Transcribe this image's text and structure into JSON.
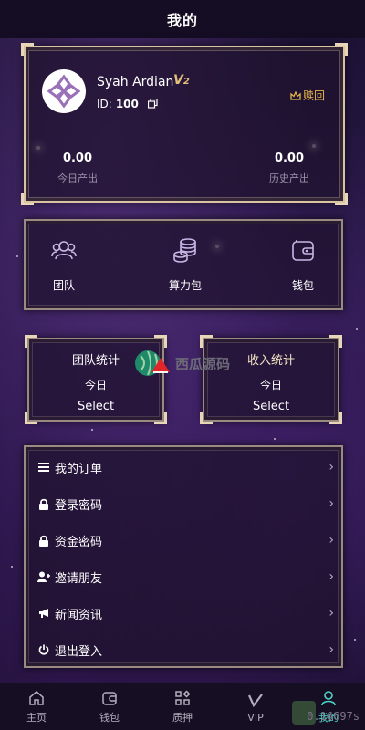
{
  "header": {
    "title": "我的"
  },
  "profile": {
    "username": "Syah Ardian",
    "vip_level": "V",
    "vip_sub": "2",
    "id_label": "ID:",
    "id_value": "100",
    "rebate_label": "赎回",
    "today_output_value": "0.00",
    "today_output_label": "今日产出",
    "history_output_value": "0.00",
    "history_output_label": "历史产出"
  },
  "quick_menu": [
    {
      "label": "团队",
      "icon": "team-icon"
    },
    {
      "label": "算力包",
      "icon": "coins-icon"
    },
    {
      "label": "钱包",
      "icon": "wallet-icon"
    }
  ],
  "stat_boxes": {
    "team": {
      "title": "团队统计",
      "period": "今日",
      "select": "Select"
    },
    "income": {
      "title": "收入统计",
      "period": "今日",
      "select": "Select"
    }
  },
  "watermark": {
    "text": "西瓜源码"
  },
  "list_menu": [
    {
      "label": "我的订单",
      "icon": "menu-icon"
    },
    {
      "label": "登录密码",
      "icon": "lock-icon"
    },
    {
      "label": "资金密码",
      "icon": "lock-icon"
    },
    {
      "label": "邀请朋友",
      "icon": "add-user-icon"
    },
    {
      "label": "新闻资讯",
      "icon": "megaphone-icon"
    },
    {
      "label": "退出登入",
      "icon": "power-icon"
    }
  ],
  "bottom_nav": [
    {
      "label": "主页",
      "icon": "home-icon"
    },
    {
      "label": "钱包",
      "icon": "wallet-icon"
    },
    {
      "label": "质押",
      "icon": "grid-icon"
    },
    {
      "label": "VIP",
      "icon": "vip-icon"
    },
    {
      "label": "我的",
      "icon": "user-icon",
      "active": true
    }
  ],
  "timer": {
    "text": "0.16697s"
  },
  "colors": {
    "accent": "#4fd2c6",
    "gold": "#e4b548",
    "frame": "#d9c3a3"
  }
}
